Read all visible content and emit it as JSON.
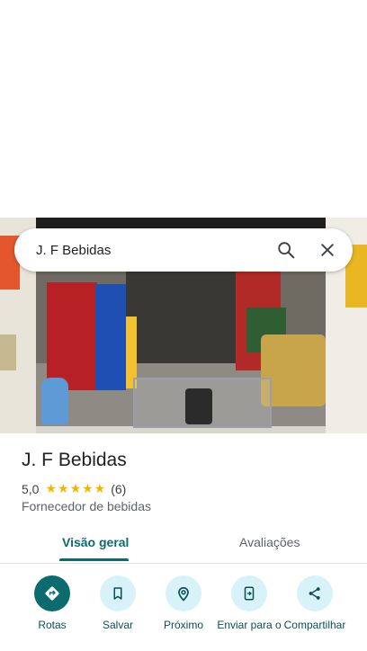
{
  "search": {
    "query": "J. F Bebidas"
  },
  "place": {
    "name": "J. F Bebidas",
    "rating": "5,0",
    "stars": "★★★★★",
    "review_count": "(6)",
    "category": "Fornecedor de bebidas"
  },
  "tabs": [
    {
      "label": "Visão geral",
      "active": true
    },
    {
      "label": "Avaliações",
      "active": false
    }
  ],
  "actions": [
    {
      "label": "Rotas",
      "icon": "directions-icon"
    },
    {
      "label": "Salvar",
      "icon": "bookmark-icon"
    },
    {
      "label": "Próximo",
      "icon": "nearby-icon"
    },
    {
      "label": "Enviar para o",
      "icon": "send-to-phone-icon"
    },
    {
      "label": "Compartilhar",
      "icon": "share-icon"
    }
  ],
  "colors": {
    "accent": "#0b6b6f",
    "chip_bg": "#d7f3f9",
    "star": "#f5b400"
  }
}
